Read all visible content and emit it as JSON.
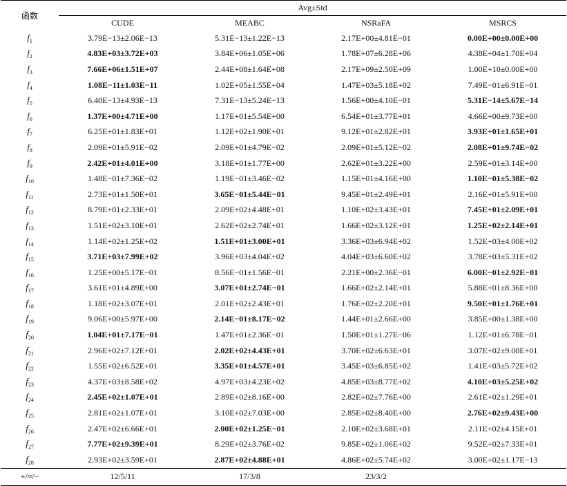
{
  "table": {
    "function_header": "函数",
    "group_header": "Avg±Std",
    "algorithms": [
      "CUDE",
      "MEABC",
      "NSRaFA",
      "MSRCS"
    ],
    "rows": [
      {
        "fn": "f",
        "sub": "1",
        "values": [
          "3.79E−13±2.06E−13",
          "5.31E−13±1.22E−13",
          "2.17E+00±4.81E−01",
          "0.00E+00±0.00E+00"
        ],
        "best": [
          3
        ]
      },
      {
        "fn": "f",
        "sub": "2",
        "values": [
          "4.83E+03±3.72E+03",
          "3.84E+06±1.05E+06",
          "1.78E+07±6.28E+06",
          "4.38E+04±1.70E+04"
        ],
        "best": [
          0
        ]
      },
      {
        "fn": "f",
        "sub": "3",
        "values": [
          "7.66E+06±1.51E+07",
          "2.44E+08±1.64E+08",
          "2.17E+09±2.50E+09",
          "1.00E+10±0.00E+00"
        ],
        "best": [
          0
        ]
      },
      {
        "fn": "f",
        "sub": "4",
        "values": [
          "1.08E−11±1.03E−11",
          "1.02E+05±1.55E+04",
          "1.47E+03±5.18E+02",
          "7.49E−01±6.91E−01"
        ],
        "best": [
          0
        ]
      },
      {
        "fn": "f",
        "sub": "5",
        "values": [
          "6.40E−13±4.93E−13",
          "7.31E−13±5.24E−13",
          "1.56E+00±4.10E−01",
          "5.31E−14±5.67E−14"
        ],
        "best": [
          3
        ]
      },
      {
        "fn": "f",
        "sub": "6",
        "values": [
          "1.37E+00±4.71E+00",
          "1.17E+01±5.54E+00",
          "6.54E+01±3.77E+01",
          "4.66E+00±9.73E+00"
        ],
        "best": [
          0
        ]
      },
      {
        "fn": "f",
        "sub": "7",
        "values": [
          "6.25E+01±1.83E+01",
          "1.12E+02±1.90E+01",
          "9.12E+01±2.82E+01",
          "3.93E+01±1.65E+01"
        ],
        "best": [
          3
        ]
      },
      {
        "fn": "f",
        "sub": "8",
        "values": [
          "2.09E+01±5.91E−02",
          "2.09E+01±4.79E−02",
          "2.09E+01±5.12E−02",
          "2.08E+01±9.74E−02"
        ],
        "best": [
          3
        ]
      },
      {
        "fn": "f",
        "sub": "9",
        "values": [
          "2.42E+01±4.01E+00",
          "3.18E+01±1.77E+00",
          "2.62E+01±3.22E+00",
          "2.59E+01±3.14E+00"
        ],
        "best": [
          0
        ]
      },
      {
        "fn": "f",
        "sub": "10",
        "values": [
          "1.48E−01±7.36E−02",
          "1.19E−01±3.46E−02",
          "1.15E+01±4.16E+00",
          "1.10E−01±5.38E−02"
        ],
        "best": [
          3
        ]
      },
      {
        "fn": "f",
        "sub": "11",
        "values": [
          "2.73E+01±1.50E+01",
          "3.65E−01±5.44E−01",
          "9.45E+01±2.49E+01",
          "2.16E+01±5.91E+00"
        ],
        "best": [
          1
        ]
      },
      {
        "fn": "f",
        "sub": "12",
        "values": [
          "8.79E+01±2.33E+01",
          "2.09E+02±4.48E+01",
          "1.10E+02±3.43E+01",
          "7.45E+01±2.09E+01"
        ],
        "best": [
          3
        ]
      },
      {
        "fn": "f",
        "sub": "13",
        "values": [
          "1.51E+02±3.10E+01",
          "2.62E+02±2.74E+01",
          "1.66E+02±3.12E+01",
          "1.25E+02±2.14E+01"
        ],
        "best": [
          3
        ]
      },
      {
        "fn": "f",
        "sub": "14",
        "values": [
          "1.14E+02±1.25E+02",
          "1.51E+01±3.00E+01",
          "3.36E+03±6.94E+02",
          "1.52E+03±4.00E+02"
        ],
        "best": [
          1
        ]
      },
      {
        "fn": "f",
        "sub": "15",
        "values": [
          "3.71E+03±7.99E+02",
          "3.96E+03±4.04E+02",
          "4.04E+03±6.60E+02",
          "3.78E+03±5.31E+02"
        ],
        "best": [
          0
        ]
      },
      {
        "fn": "f",
        "sub": "16",
        "values": [
          "1.25E+00±5.17E−01",
          "8.56E−01±1.56E−01",
          "2.21E+00±2.36E−01",
          "6.00E−01±2.92E−01"
        ],
        "best": [
          3
        ]
      },
      {
        "fn": "f",
        "sub": "17",
        "values": [
          "3.61E+01±4.89E+00",
          "3.07E+01±2.74E−01",
          "1.66E+02±2.14E+01",
          "5.88E+01±8.36E+00"
        ],
        "best": [
          1
        ]
      },
      {
        "fn": "f",
        "sub": "18",
        "values": [
          "1.18E+02±3.07E+01",
          "2.01E+02±2.43E+01",
          "1.76E+02±2.20E+01",
          "9.50E+01±1.76E+01"
        ],
        "best": [
          3
        ]
      },
      {
        "fn": "f",
        "sub": "19",
        "values": [
          "9.06E+00±5.97E+00",
          "2.14E−01±8.17E−02",
          "1.44E+01±2.66E+00",
          "3.85E+00±1.38E+00"
        ],
        "best": [
          1
        ]
      },
      {
        "fn": "f",
        "sub": "20",
        "values": [
          "1.04E+01±7.17E−01",
          "1.47E+01±2.36E−01",
          "1.50E+01±1.27E−06",
          "1.12E+01±6.78E−01"
        ],
        "best": [
          0
        ]
      },
      {
        "fn": "f",
        "sub": "21",
        "values": [
          "2.96E+02±7.12E+01",
          "2.02E+02±4.43E+01",
          "3.70E+02±6.63E+01",
          "3.07E+02±9.00E+01"
        ],
        "best": [
          1
        ]
      },
      {
        "fn": "f",
        "sub": "22",
        "values": [
          "1.55E+02±6.52E+01",
          "3.35E+01±4.57E+01",
          "3.45E+03±6.85E+02",
          "1.41E+03±5.72E+02"
        ],
        "best": [
          1
        ]
      },
      {
        "fn": "f",
        "sub": "23",
        "values": [
          "4.37E+03±8.58E+02",
          "4.97E+03±4.23E+02",
          "4.85E+03±8.77E+02",
          "4.10E+03±5.25E+02"
        ],
        "best": [
          3
        ]
      },
      {
        "fn": "f",
        "sub": "24",
        "values": [
          "2.45E+02±1.07E+01",
          "2.89E+02±8.16E+00",
          "2.82E+02±7.76E+00",
          "2.61E+02±1.29E+01"
        ],
        "best": [
          0
        ]
      },
      {
        "fn": "f",
        "sub": "25",
        "values": [
          "2.81E+02±1.07E+01",
          "3.10E+02±7.03E+00",
          "2.85E+02±8.40E+00",
          "2.76E+02±9.43E+00"
        ],
        "best": [
          3
        ]
      },
      {
        "fn": "f",
        "sub": "26",
        "values": [
          "2.47E+02±6.66E+01",
          "2.00E+02±1.25E−01",
          "2.10E+02±3.68E+01",
          "2.11E+02±4.15E+01"
        ],
        "best": [
          1
        ]
      },
      {
        "fn": "f",
        "sub": "27",
        "values": [
          "7.77E+02±9.39E+01",
          "8.29E+02±3.76E+02",
          "9.85E+02±1.06E+02",
          "9.52E+02±7.33E+01"
        ],
        "best": [
          0
        ]
      },
      {
        "fn": "f",
        "sub": "28",
        "values": [
          "2.93E+02±3.59E+01",
          "2.87E+02±4.88E+01",
          "4.86E+02±5.74E+02",
          "3.00E+02±1.17E−13"
        ],
        "best": [
          1
        ]
      }
    ],
    "summary": {
      "label": "+/≈/−",
      "values": [
        "12/5/11",
        "17/3/8",
        "23/3/2",
        ""
      ]
    }
  }
}
